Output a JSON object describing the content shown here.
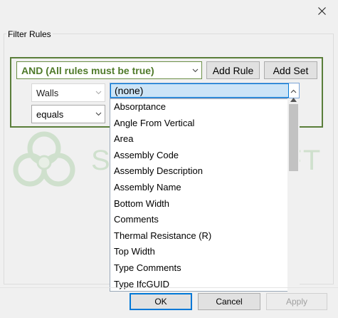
{
  "window": {
    "close_icon": "close-icon"
  },
  "filter_rules": {
    "group_label": "Filter Rules",
    "logic_combo": "AND (All rules must be true)",
    "add_rule_label": "Add Rule",
    "add_set_label": "Add Set",
    "rule": {
      "field": "Walls",
      "operator": "equals",
      "parameter_selected": "(none)"
    }
  },
  "parameter_dropdown": {
    "items": [
      "Absorptance",
      "Angle From Vertical",
      "Area",
      "Assembly Code",
      "Assembly Description",
      "Assembly Name",
      "Bottom Width",
      "Comments",
      "Thermal Resistance (R)",
      "Top Width",
      "Type Comments",
      "Type IfcGUID"
    ]
  },
  "watermark": {
    "text": "SYNERGYSOFT"
  },
  "footer": {
    "ok_label": "OK",
    "cancel_label": "Cancel",
    "apply_label": "Apply"
  },
  "colors": {
    "accent_green": "#4f7a2a",
    "selection_blue": "#cce4f7",
    "focus_blue": "#0078d7"
  }
}
